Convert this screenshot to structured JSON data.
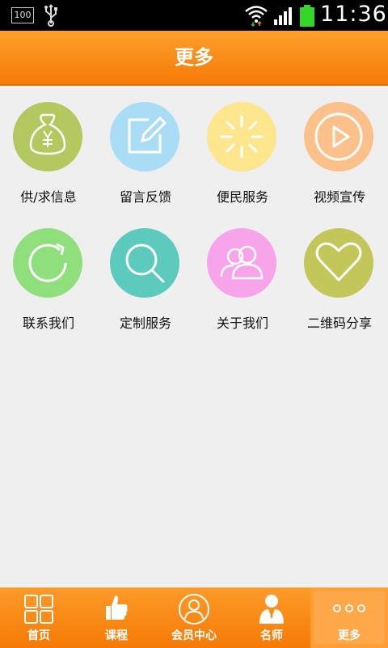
{
  "status_bar": {
    "battery_percent_text": "100",
    "time": "11:36",
    "battery_color": "#35d62a"
  },
  "header": {
    "title": "更多",
    "color": "#f88a10"
  },
  "grid_items": [
    {
      "label": "供/求信息",
      "icon": "money-bag-icon",
      "color": "#b4c860"
    },
    {
      "label": "留言反馈",
      "icon": "edit-icon",
      "color": "#a9ddf5"
    },
    {
      "label": "便民服务",
      "icon": "loading-icon",
      "color": "#fde68e"
    },
    {
      "label": "视频宣传",
      "icon": "play-icon",
      "color": "#fcc18a"
    },
    {
      "label": "联系我们",
      "icon": "refresh-icon",
      "color": "#8fe07d"
    },
    {
      "label": "定制服务",
      "icon": "search-icon",
      "color": "#5ccbbd"
    },
    {
      "label": "关于我们",
      "icon": "users-icon",
      "color": "#f7a4ea"
    },
    {
      "label": "二维码分享",
      "icon": "heart-icon",
      "color": "#c3c659"
    }
  ],
  "tabs": [
    {
      "label": "首页",
      "icon": "grid-icon",
      "active": false
    },
    {
      "label": "课程",
      "icon": "thumbs-up-icon",
      "active": false
    },
    {
      "label": "会员中心",
      "icon": "user-circle-icon",
      "active": false
    },
    {
      "label": "名师",
      "icon": "teacher-icon",
      "active": false
    },
    {
      "label": "更多",
      "icon": "more-icon",
      "active": true
    }
  ]
}
